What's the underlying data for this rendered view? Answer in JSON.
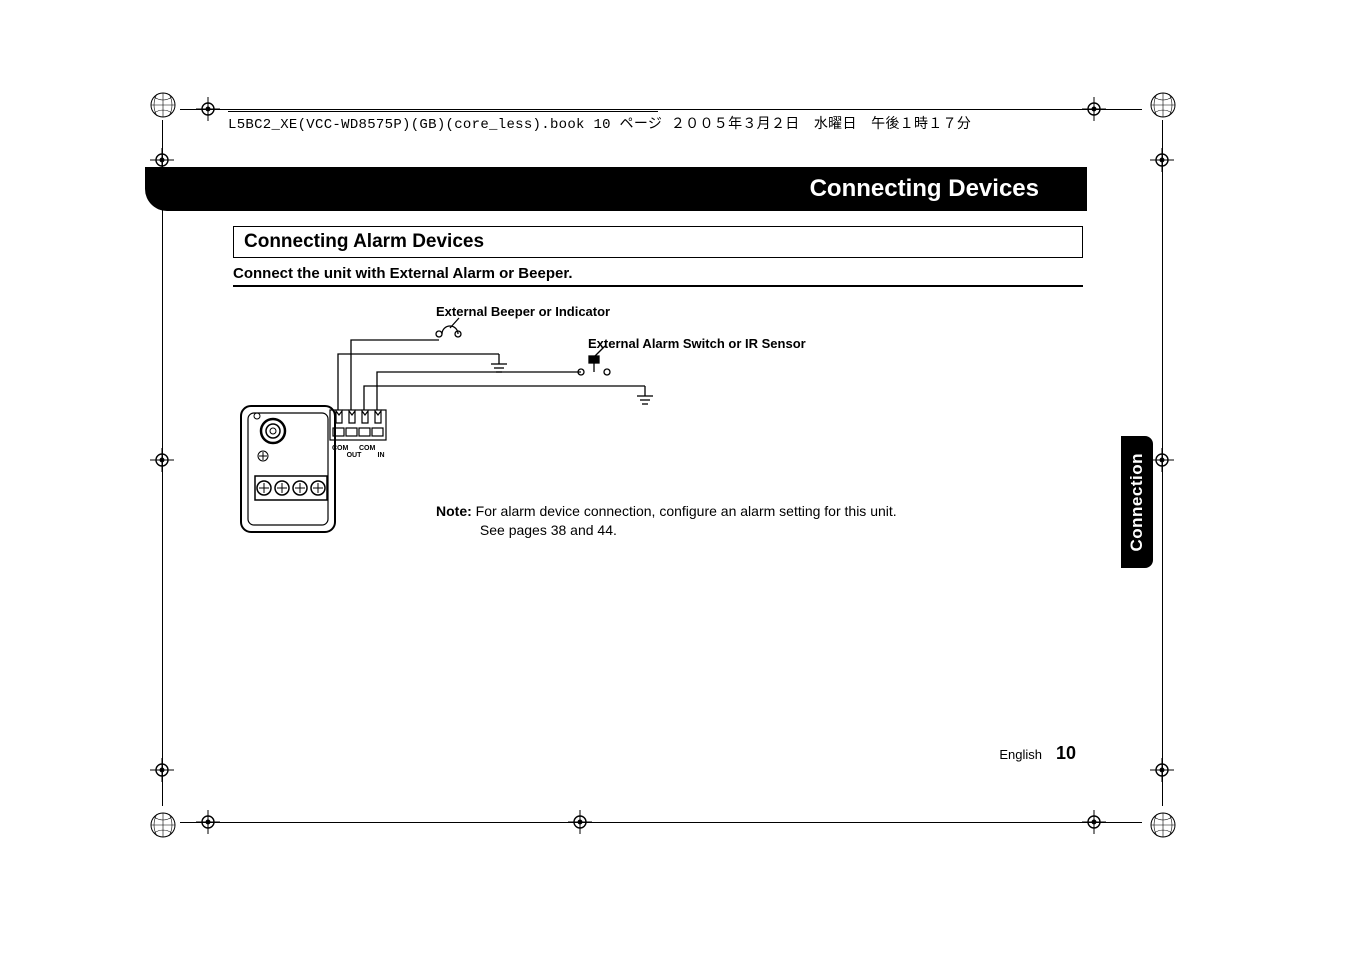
{
  "header": {
    "file_info": "L5BC2_XE(VCC-WD8575P)(GB)(core_less).book  10 ページ  ２００５年３月２日　水曜日　午後１時１７分"
  },
  "title": "Connecting Devices",
  "section": "Connecting Alarm Devices",
  "subheading": "Connect the unit with External Alarm or Beeper.",
  "diagram": {
    "label_beeper": "External Beeper or Indicator",
    "label_alarm": "External Alarm Switch or IR Sensor",
    "terminals": {
      "com1": "COM",
      "out": "OUT",
      "com2": "COM",
      "in": "IN"
    }
  },
  "note": {
    "label": "Note:",
    "line1": "For alarm device connection, configure an alarm setting for this unit.",
    "line2": "See pages 38 and 44."
  },
  "side_tab": "Connection",
  "footer": {
    "lang": "English",
    "page": "10"
  }
}
